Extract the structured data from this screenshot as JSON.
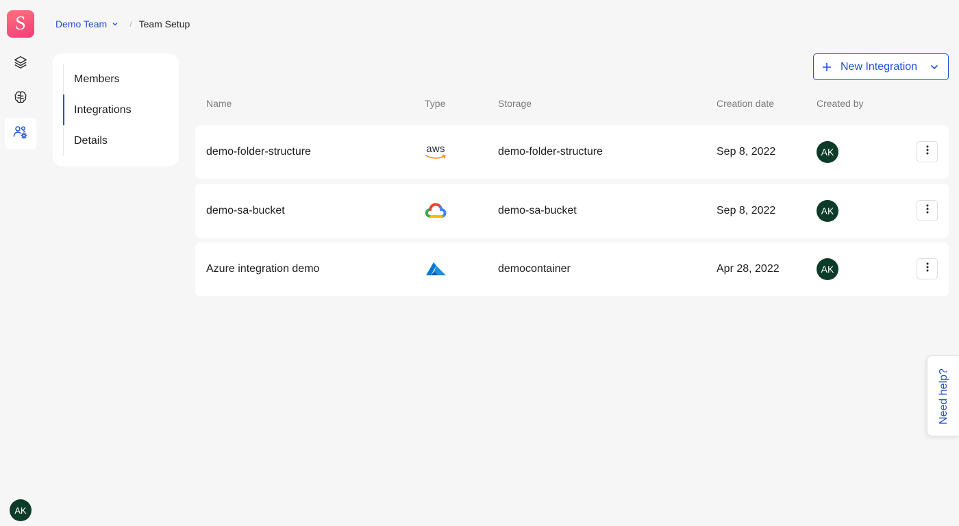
{
  "app": {
    "logo_letter": "S",
    "brand_color": "#f23f7a",
    "accent_color": "#1f4fd8"
  },
  "rail": {
    "items": [
      {
        "icon": "layers-icon",
        "active": false
      },
      {
        "icon": "brain-icon",
        "active": false
      },
      {
        "icon": "team-settings-icon",
        "active": true
      }
    ],
    "user_initials": "AK"
  },
  "breadcrumb": {
    "team": "Demo Team",
    "separator": "/",
    "page": "Team Setup"
  },
  "subnav": {
    "items": [
      {
        "label": "Members",
        "active": false
      },
      {
        "label": "Integrations",
        "active": true
      },
      {
        "label": "Details",
        "active": false
      }
    ]
  },
  "new_integration_button": {
    "label": "New Integration"
  },
  "table": {
    "columns": [
      "Name",
      "Type",
      "Storage",
      "Creation date",
      "Created by"
    ],
    "rows": [
      {
        "name": "demo-folder-structure",
        "type": "aws",
        "type_label": "aws",
        "storage": "demo-folder-structure",
        "creation_date": "Sep 8, 2022",
        "created_by": "AK"
      },
      {
        "name": "demo-sa-bucket",
        "type": "google-cloud",
        "storage": "demo-sa-bucket",
        "creation_date": "Sep 8, 2022",
        "created_by": "AK"
      },
      {
        "name": "Azure integration demo",
        "type": "azure",
        "storage": "democontainer",
        "creation_date": "Apr 28, 2022",
        "created_by": "AK"
      }
    ]
  },
  "help_tab": {
    "label": "Need help?"
  }
}
